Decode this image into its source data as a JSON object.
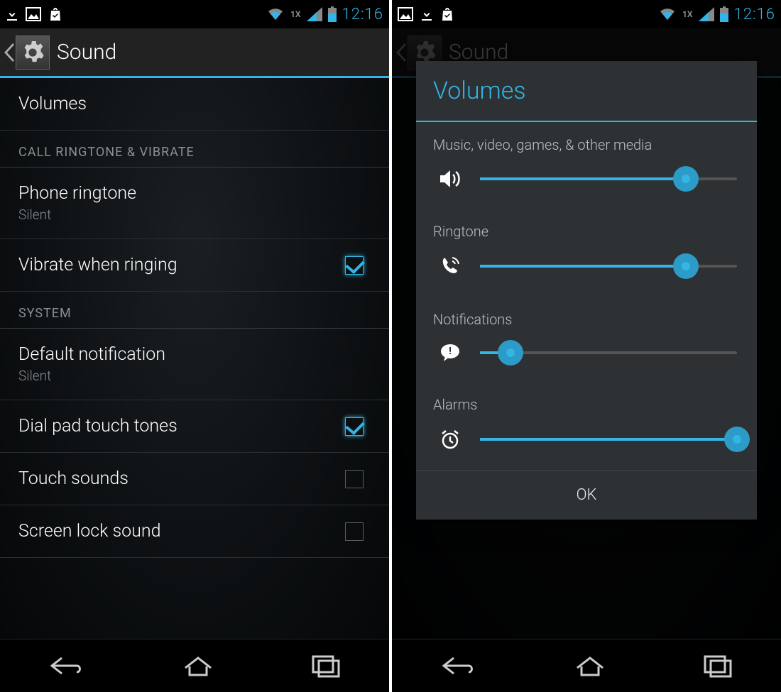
{
  "status": {
    "time": "12:16",
    "network_label": "1X"
  },
  "screen1": {
    "title": "Sound",
    "items": {
      "volumes": "Volumes",
      "section_ring": "CALL RINGTONE & VIBRATE",
      "phone_ringtone": {
        "title": "Phone ringtone",
        "sub": "Silent"
      },
      "vibrate_ringing": {
        "title": "Vibrate when ringing",
        "checked": true
      },
      "section_system": "SYSTEM",
      "default_notif": {
        "title": "Default notification",
        "sub": "Silent"
      },
      "dialpad": {
        "title": "Dial pad touch tones",
        "checked": true
      },
      "touch_sounds": {
        "title": "Touch sounds",
        "checked": false
      },
      "screen_lock": {
        "title": "Screen lock sound",
        "checked": false
      }
    }
  },
  "screen2": {
    "title": "Sound",
    "dialog_title": "Volumes",
    "sliders": {
      "media": {
        "label": "Music, video, games, & other media",
        "value": 80
      },
      "ring": {
        "label": "Ringtone",
        "value": 80
      },
      "notif": {
        "label": "Notifications",
        "value": 12
      },
      "alarm": {
        "label": "Alarms",
        "value": 100
      }
    },
    "ok": "OK"
  }
}
